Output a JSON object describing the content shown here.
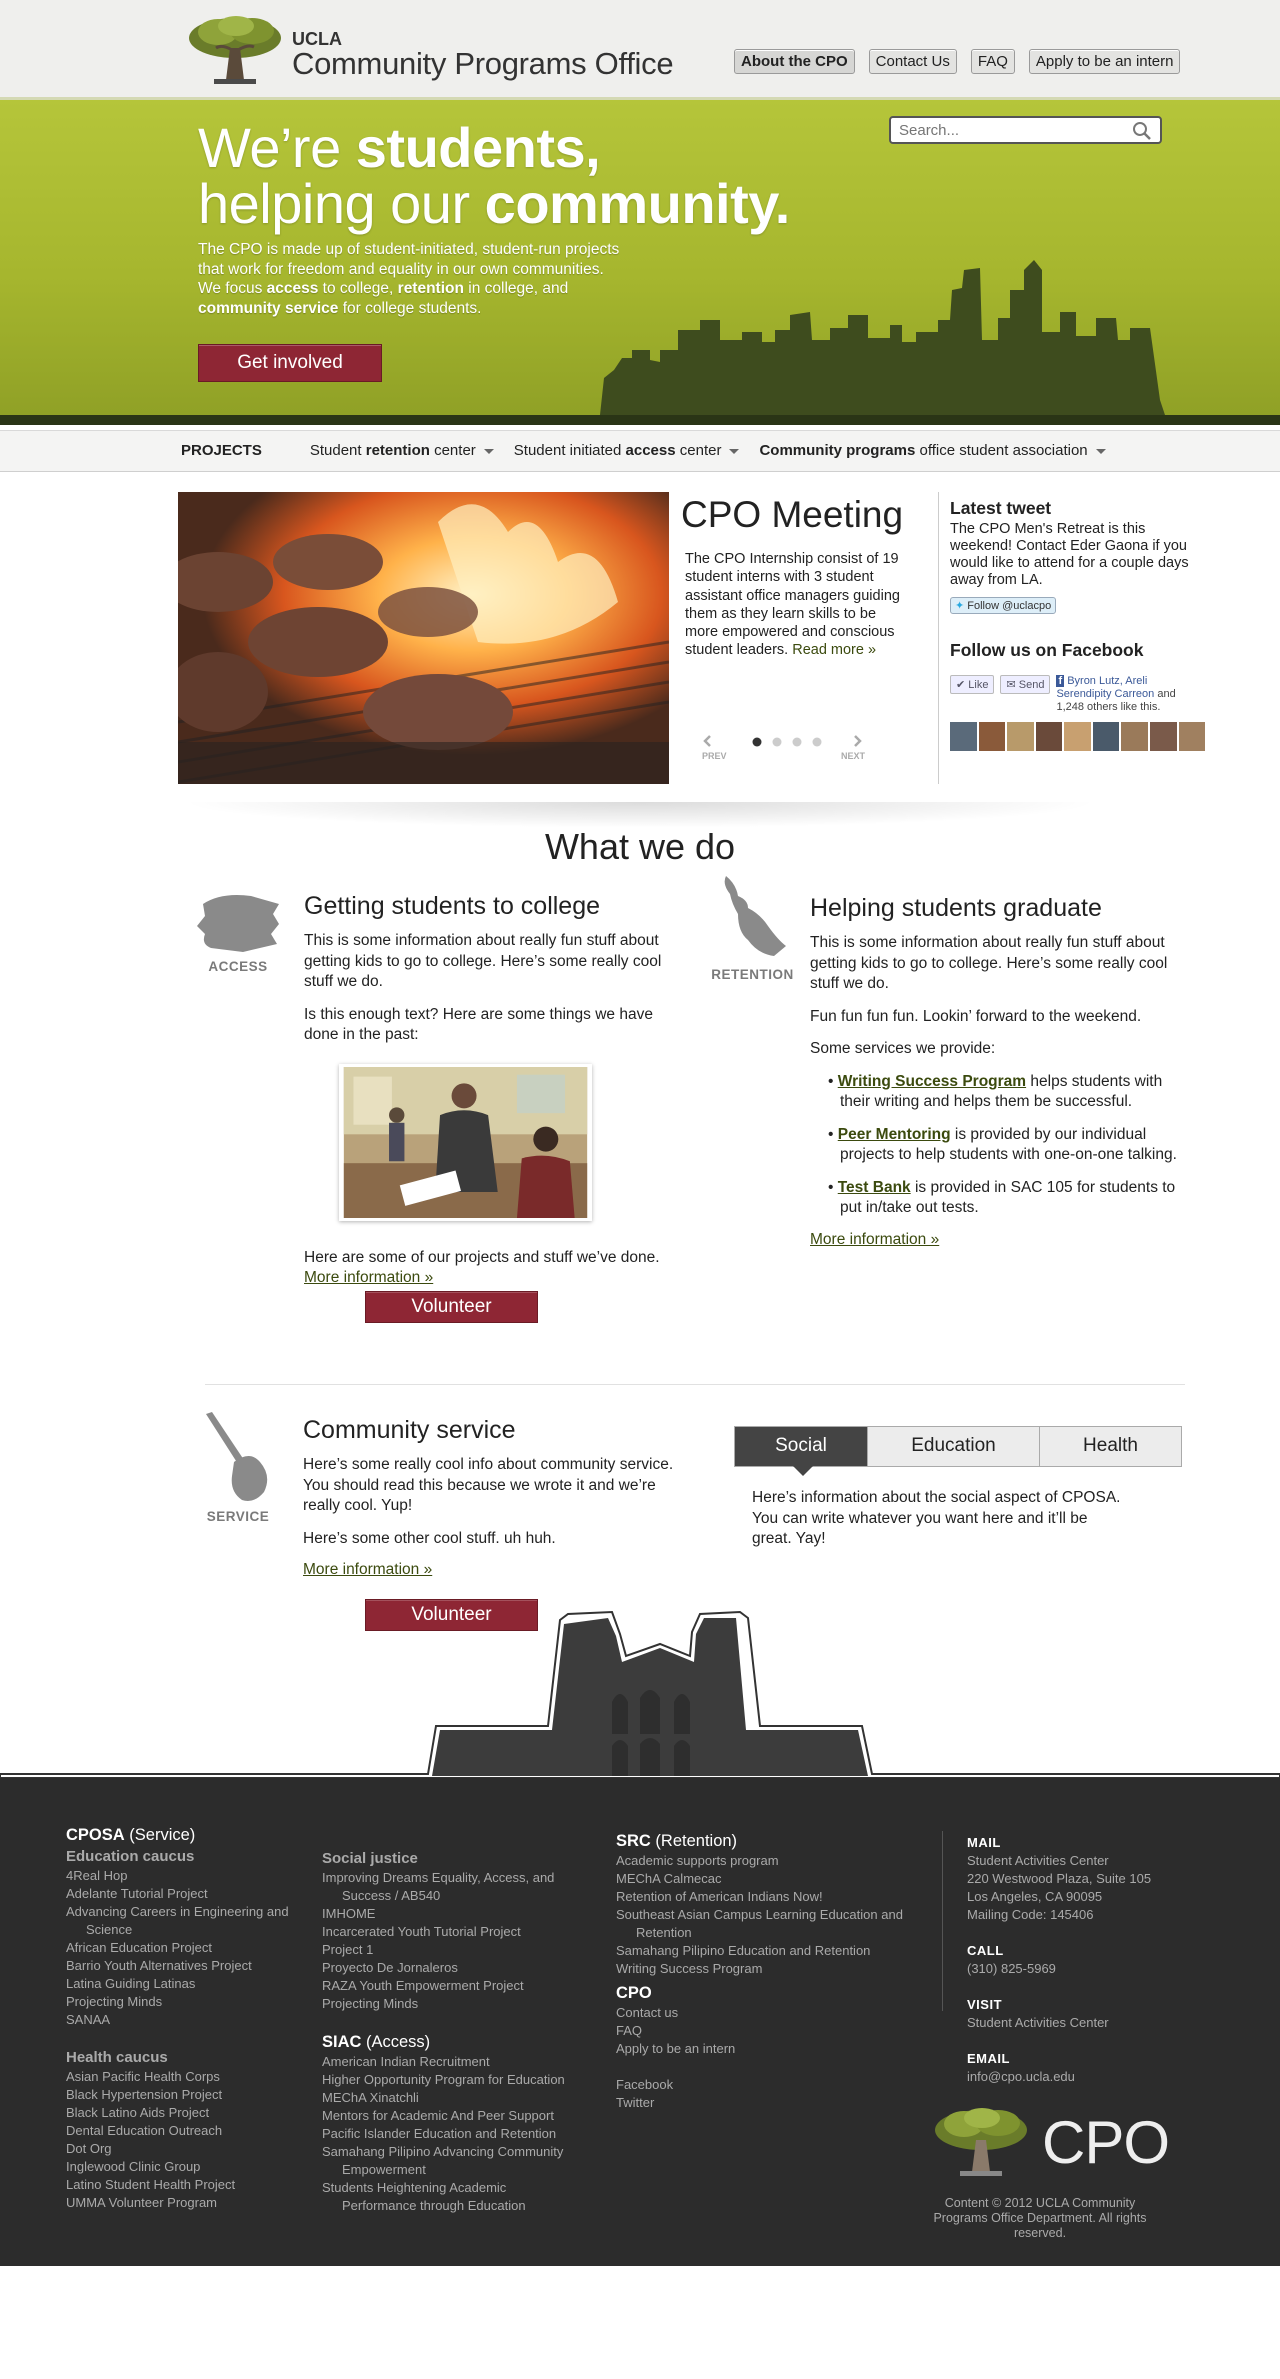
{
  "header": {
    "ucla": "UCLA",
    "title": "Community Programs Office",
    "nav": [
      "About the CPO",
      "Contact Us",
      "FAQ",
      "Apply to be an intern"
    ]
  },
  "hero": {
    "search_placeholder": "Search...",
    "line1_a": "We’re ",
    "line1_b": "students,",
    "line2_a": "helping our ",
    "line2_b": "community.",
    "intro_1": "The CPO is made up of student-initiated, student-run projects that work for freedom and equality in our own communities. We focus ",
    "intro_access": "access",
    "intro_2": " to college, ",
    "intro_retention": "retention",
    "intro_3": " in college, and ",
    "intro_cs": "community service",
    "intro_4": " for college students.",
    "button": "Get involved",
    "accent": "#8e2634"
  },
  "projects_bar": {
    "label": "PROJECTS",
    "items": [
      {
        "pre": "Student ",
        "bold": "retention",
        "post": " center"
      },
      {
        "pre": "Student initiated ",
        "bold": "access",
        "post": " center"
      },
      {
        "pre": "",
        "bold": "Community programs",
        "post": " office student association"
      }
    ]
  },
  "feature": {
    "title": "CPO Meeting",
    "body": "The CPO Internship consist of 19 student interns with 3 student assistant office managers guiding them as they learn skills to be more empowered and conscious student leaders. ",
    "read_more": "Read more »",
    "prev": "PREV",
    "next": "NEXT",
    "dots": 4
  },
  "sidebar": {
    "tweet_head": "Latest tweet",
    "tweet": "The CPO Men's Retreat is this weekend! Contact Eder Gaona if you would like to attend for a couple days away from LA.",
    "follow": "Follow @uclacpo",
    "fb_head": "Follow us on Facebook",
    "like": "Like",
    "send": "Send",
    "fb_names": "Byron Lutz, Areli Serendipity Carreon",
    "fb_rest": " and 1,248 others like this."
  },
  "what_we_do": {
    "title": "What we do",
    "access": {
      "icon_label": "ACCESS",
      "title": "Getting students to college",
      "p1": "This is some information about really fun stuff about getting kids to go to college. Here’s some really cool stuff we do.",
      "p2": "Is this enough text? Here are some things we have done in the past:",
      "p3": "Here are some of our projects and stuff we’ve done. ",
      "more": "More information »",
      "volunteer": "Volunteer"
    },
    "retention": {
      "icon_label": "RETENTION",
      "title": "Helping students graduate",
      "p1": "This is some information about really fun stuff about getting kids to go to college. Here’s some really cool stuff we do.",
      "p2": "Fun fun fun fun. Lookin’ forward to the weekend.",
      "p3": "Some services we provide:",
      "services": [
        {
          "name": "Writing Success Program",
          "desc": " helps students with their writing and helps them be successful."
        },
        {
          "name": "Peer Mentoring",
          "desc": " is provided by our individual projects to help students with one-on-one talking."
        },
        {
          "name": "Test Bank",
          "desc": " is provided in SAC 105 for students to put in/take out tests."
        }
      ],
      "more": "More information »"
    },
    "service": {
      "icon_label": "SERVICE",
      "title": "Community service",
      "p1": "Here’s some really cool info about community service. You should read this because we wrote it and we’re really cool. Yup!",
      "p2": "Here’s some other cool stuff. uh huh.",
      "more": "More information »",
      "volunteer": "Volunteer"
    },
    "tabs": [
      "Social",
      "Education",
      "Health"
    ],
    "tab_text": "Here’s information about the social aspect of CPOSA. You can write whatever you want here and it’ll be great. Yay!"
  },
  "footer": {
    "cposa_h": "CPOSA",
    "cposa_sub": " (Service)",
    "edu_h": "Education caucus",
    "edu": [
      "4Real Hop",
      "Adelante Tutorial Project",
      "Advancing Careers in Engineering and Science",
      "African Education Project",
      "Barrio Youth Alternatives Project",
      "Latina Guiding Latinas",
      "Projecting Minds",
      "SANAA"
    ],
    "health_h": "Health caucus",
    "health": [
      "Asian Pacific Health Corps",
      "Black Hypertension Project",
      "Black Latino Aids Project",
      "Dental Education Outreach",
      "Dot Org",
      "Inglewood Clinic Group",
      "Latino Student Health Project",
      "UMMA Volunteer Program"
    ],
    "sj_h": "Social justice",
    "sj": [
      "Improving Dreams Equality, Access, and Success / AB540",
      "IMHOME",
      "Incarcerated Youth Tutorial Project",
      "Project 1",
      "Proyecto De Jornaleros",
      "RAZA Youth Empowerment Project",
      "Projecting Minds"
    ],
    "siac_h": "SIAC",
    "siac_sub": " (Access)",
    "siac": [
      "American Indian Recruitment",
      "Higher Opportunity Program for Education",
      "MEChA Xinatchli",
      "Mentors for Academic And Peer Support",
      "Pacific Islander Education and Retention",
      "Samahang Pilipino Advancing Community Empowerment",
      "Students Heightening Academic Performance through Education"
    ],
    "src_h": "SRC",
    "src_sub": " (Retention)",
    "src": [
      "Academic supports program",
      "MEChA Calmecac",
      "Retention of American Indians Now!",
      "Southeast Asian Campus Learning Education and Retention",
      "Samahang Pilipino Education and Retention",
      "Writing Success Program"
    ],
    "cpo_h": "CPO",
    "cpo": [
      "Contact us",
      "FAQ",
      "Apply to be an intern"
    ],
    "social": [
      "Facebook",
      "Twitter"
    ],
    "mail_h": "MAIL",
    "mail": [
      "Student Activities Center",
      "220 Westwood Plaza, Suite 105",
      "Los Angeles, CA 90095",
      "Mailing Code: 145406"
    ],
    "call_h": "CALL",
    "call": "(310) 825-5969",
    "visit_h": "VISIT",
    "visit": "Student Activities Center",
    "email_h": "EMAIL",
    "email": "info@cpo.ucla.edu",
    "logo_text": "CPO",
    "copyright": "Content © 2012 UCLA Community Programs Office Department. All rights reserved."
  }
}
